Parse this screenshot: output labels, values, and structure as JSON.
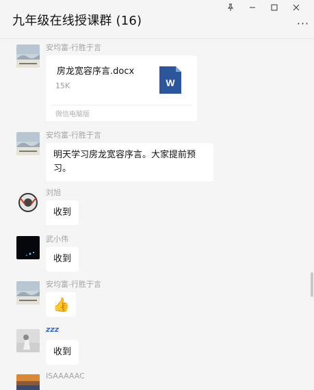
{
  "window": {
    "title": "九年级在线授课群 (16)",
    "controls": {
      "pin": "⊼",
      "minimize": "—",
      "maximize": "☐",
      "close": "✕"
    },
    "more": "···"
  },
  "messages": [
    {
      "sender": "安均富-行胜于言",
      "type": "file",
      "file": {
        "name": "房龙宽容序言.docx",
        "size": "15K",
        "source": "微信电脑版",
        "icon": "word-doc-icon",
        "icon_letter": "W"
      }
    },
    {
      "sender": "安均富-行胜于言",
      "type": "text",
      "text_line1": "明天学习房龙宽容序言。大家提前预",
      "text_line2": "习。"
    },
    {
      "sender": "刘旭",
      "type": "text",
      "text": "收到"
    },
    {
      "sender": "武小伟",
      "type": "text",
      "text": "收到"
    },
    {
      "sender": "安均富-行胜于言",
      "type": "emoji",
      "emoji": "👍"
    },
    {
      "sender": "",
      "status_icon": "zzz",
      "type": "text",
      "text": "收到"
    },
    {
      "sender": "ISAAAAAC",
      "type": "partial"
    }
  ],
  "colors": {
    "background": "#f5f5f5",
    "bubble": "#ffffff",
    "sender_text": "#a3a3a3",
    "word_blue": "#2b579a"
  }
}
